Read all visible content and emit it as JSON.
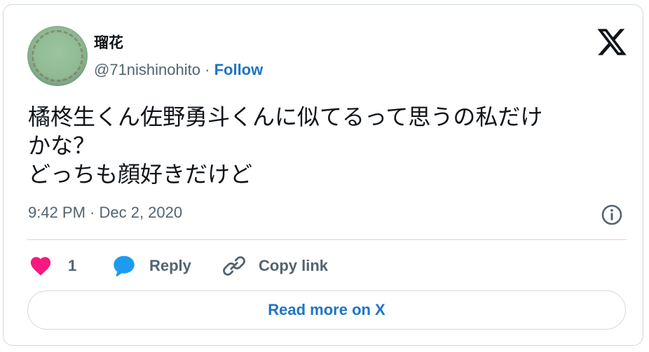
{
  "author": {
    "display_name": "瑠花",
    "handle": "@71nishinohito",
    "separator": "·",
    "follow_label": "Follow"
  },
  "tweet": {
    "lines": [
      "橘柊生くん佐野勇斗くんに似てるって思うの私だけ",
      "かな？",
      "どっちも顔好きだけど"
    ],
    "timestamp": "9:42 PM · Dec 2, 2020"
  },
  "actions": {
    "like_count": "1",
    "reply_label": "Reply",
    "copy_link_label": "Copy link"
  },
  "read_more_label": "Read more on X",
  "icons": {
    "brand": "x-logo-icon",
    "info": "info-icon",
    "like": "heart-icon",
    "reply": "speech-bubble-icon",
    "copy": "link-icon"
  },
  "colors": {
    "heart": "#f91880",
    "reply_bubble": "#1d9bf0",
    "link_blue": "#1d75c4",
    "muted_text": "#536471",
    "border": "#cfd9de"
  }
}
